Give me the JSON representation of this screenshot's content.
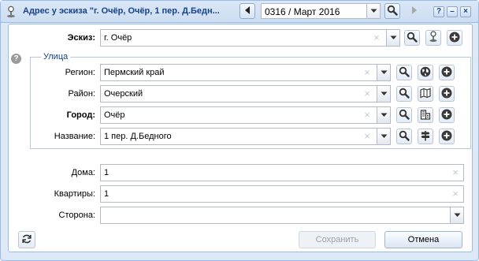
{
  "window": {
    "title": "Адрес у эскиза \"г. Очёр, Очёр, 1 пер. Д.Бедн...",
    "period_value": "0316 / Март 2016",
    "help_tool": "?",
    "minimize_tool": "–",
    "close_tool": "×"
  },
  "sketch": {
    "label": "Эскиз:",
    "value": "г. Очёр"
  },
  "street_group": {
    "legend": "Улица",
    "help_icon": "?",
    "fields": [
      {
        "label": "Регион:",
        "value": "Пермский край"
      },
      {
        "label": "Район:",
        "value": "Очерский"
      },
      {
        "label": "Город:",
        "value": "Очёр"
      },
      {
        "label": "Название:",
        "value": "1 пер. Д.Бедного"
      }
    ]
  },
  "house": {
    "label": "Дома:",
    "value": "1"
  },
  "apartments": {
    "label": "Квартиры:",
    "value": "1"
  },
  "side": {
    "label": "Сторона:",
    "value": ""
  },
  "footer": {
    "save_label": "Сохранить",
    "cancel_label": "Отмена"
  },
  "colors": {
    "title_text": "#15428b",
    "border": "#99bbe8",
    "window_bg": "#dfe8f6"
  },
  "icons": [
    "pin-icon",
    "arrow-left-icon",
    "arrow-right-icon",
    "search-icon",
    "map-pin-icon",
    "plus-circle-icon",
    "globe-icon",
    "map-icon",
    "building-icon",
    "signpost-icon",
    "refresh-icon",
    "clear-icon",
    "chevron-down-icon"
  ]
}
